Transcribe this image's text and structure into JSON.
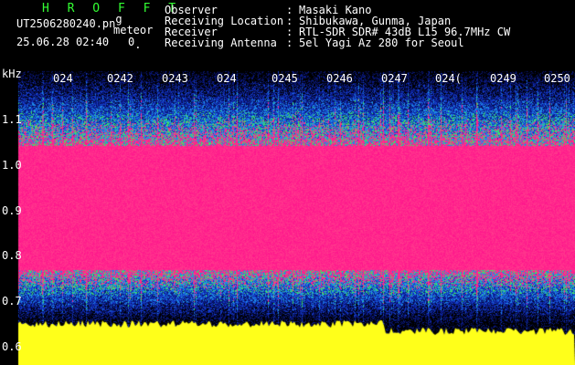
{
  "app": {
    "name": "H R O F F T",
    "name_color": "#33ff33"
  },
  "file": {
    "name": "UT2506280240.pn",
    "name_suffix": "g",
    "date_time": "25.06.28 02:40",
    "meteor_label": "meteor",
    "meteor_count": "0",
    "meteor_count_suffix": "."
  },
  "header": {
    "rows": [
      {
        "label": "Observer",
        "value": "Masaki Kano"
      },
      {
        "label": "Receiving Location",
        "value": "Shibukawa, Gunma, Japan"
      },
      {
        "label": "Receiver",
        "value": "RTL-SDR SDR# 43dB L15 96.7MHz CW"
      },
      {
        "label": "Receiving Antenna",
        "value": "5el Yagi Az 280 for Seoul"
      }
    ],
    "separator": ":"
  },
  "axis": {
    "unit": "kHz",
    "ticks": [
      "1.1",
      "1.0",
      "0.9",
      "0.8",
      "0.7",
      "0.6"
    ],
    "time_labels": [
      "024",
      "0242",
      "0243",
      "024",
      "0245",
      "0246",
      "0247",
      "024(",
      "0249",
      "0250"
    ]
  },
  "colors": {
    "background": "#000000",
    "band_core": "#ff1a8c",
    "band_edge_green": "#33ff66",
    "band_edge_blue": "#1a66ff",
    "noise_floor": "#ffff1a",
    "deep_blue": "#0a1a8c"
  }
}
